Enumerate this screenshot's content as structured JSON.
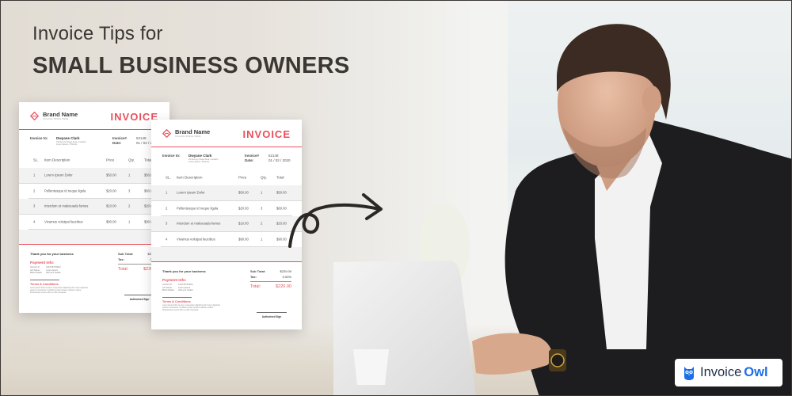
{
  "heading": {
    "line1": "Invoice Tips for",
    "line2": "SMALL BUSINESS OWNERS"
  },
  "colors": {
    "accent_red": "#e9505c",
    "title_text": "#3b3733",
    "logo_blue": "#1b6ee8",
    "logo_dark": "#22314a"
  },
  "invoice": {
    "brand_name": "Brand Name",
    "brand_tagline": "TAGLINE SPACE HERE",
    "title": "INVOICE",
    "bill_to_label": "Invoice to:",
    "client_name": "Dwyane Clark",
    "client_address": "24 Dummy Street Area, Location, Lorem Ipsum, 570xx4x",
    "invoice_no_label": "Invoice#",
    "invoice_no": "52148",
    "date_label": "Date:",
    "date": "01 / 02 / 2020",
    "columns": [
      "SL.",
      "Item Description",
      "Price",
      "Qty.",
      "Total"
    ],
    "rows": [
      {
        "sl": "1",
        "desc": "Lorem Ipsum Dolor",
        "price": "$50.00",
        "qty": "1",
        "total": "$50.00"
      },
      {
        "sl": "2",
        "desc": "Pellentesque id neque ligula",
        "price": "$20.00",
        "qty": "3",
        "total": "$60.00"
      },
      {
        "sl": "3",
        "desc": "Interdum et malesuada fames",
        "price": "$10.00",
        "qty": "2",
        "total": "$20.00"
      },
      {
        "sl": "4",
        "desc": "Vivamus volutpat faucibus",
        "price": "$90.00",
        "qty": "1",
        "total": "$90.00"
      }
    ],
    "thanks": "Thank you for your business",
    "payment_title": "Payment Info:",
    "payment_rows": [
      {
        "label": "Account #:",
        "value": "1234 5678 9012"
      },
      {
        "label": "A/C Name:",
        "value": "Lorem Ipsum"
      },
      {
        "label": "Bank Details:",
        "value": "Add your details"
      }
    ],
    "terms_title": "Terms & Conditions",
    "terms_text": "Lorem ipsum dolor sit amet, consectetur adipiscing elit. Fusce dignissim pretium consectetur. Curabitur tempor posuere massa in varius. Pellentesque viverra nibh eu nibh consequat.",
    "subtotal_label": "Sub Total:",
    "subtotal": "$220.00",
    "tax_label": "Tax:",
    "tax": "0.00%",
    "total_label": "Total:",
    "total": "$220.00",
    "signature_label": "Authorised Sign"
  },
  "logo": {
    "icon": "owl-icon",
    "text_main": "Invoice",
    "text_accent": "Owl"
  }
}
